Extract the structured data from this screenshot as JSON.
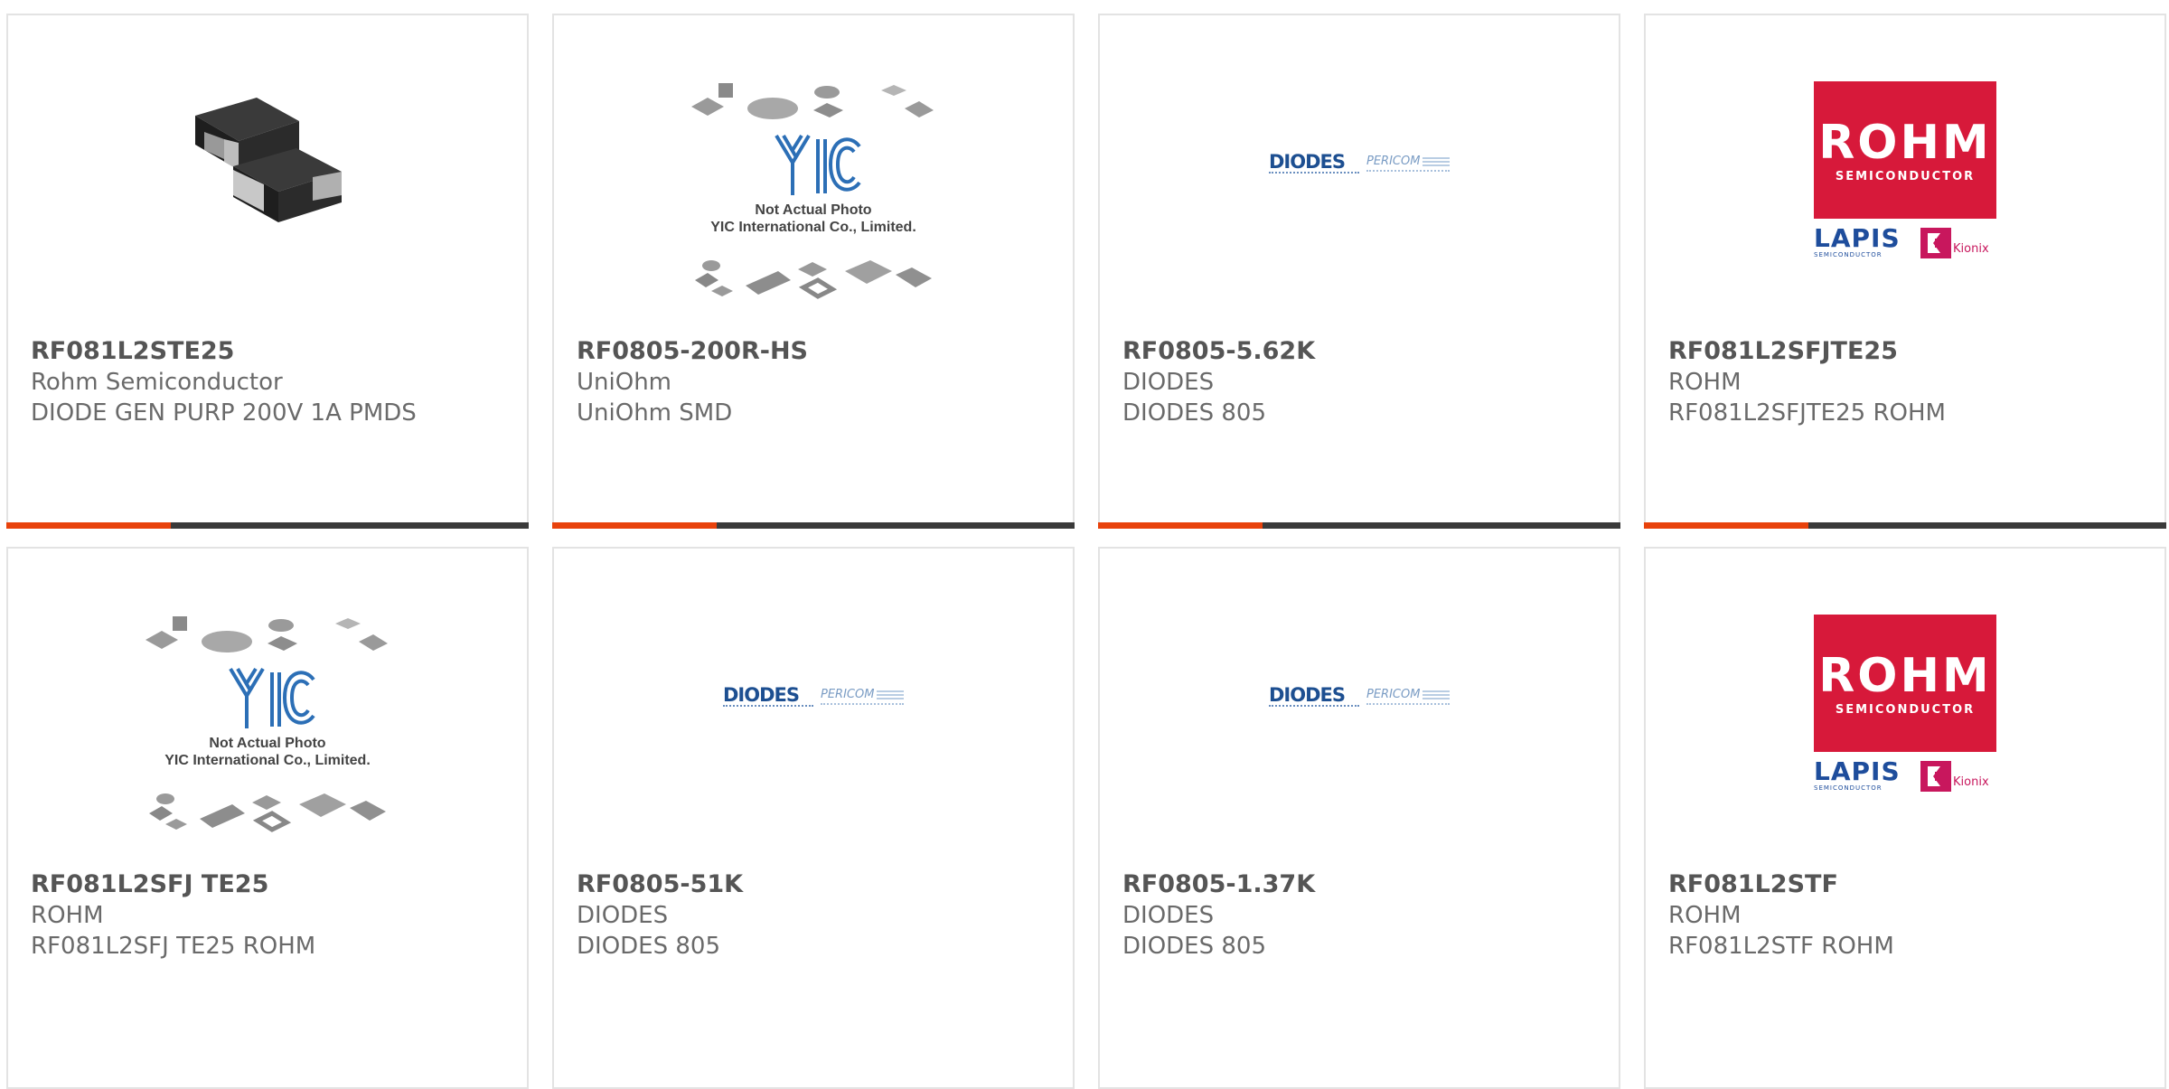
{
  "products": [
    {
      "part_number": "RF081L2STE25",
      "manufacturer": "Rohm Semiconductor",
      "description": "DIODE GEN PURP 200V 1A PMDS",
      "image": "diode-photo"
    },
    {
      "part_number": "RF0805-200R-HS",
      "manufacturer": "UniOhm",
      "description": "UniOhm SMD",
      "image": "yic-placeholder",
      "image_text": [
        "Not Actual Photo",
        "YIC International Co., Limited."
      ]
    },
    {
      "part_number": "RF0805-5.62K",
      "manufacturer": "DIODES",
      "description": "DIODES 805",
      "image": "diodes-pericom-logo",
      "image_text": [
        "DIODES",
        "PERICOM"
      ]
    },
    {
      "part_number": "RF081L2SFJTE25",
      "manufacturer": "ROHM",
      "description": "RF081L2SFJTE25 ROHM",
      "image": "rohm-lapis-kionix-logo",
      "image_text": [
        "ROHM",
        "SEMICONDUCTOR",
        "LAPIS",
        "SEMICONDUCTOR",
        "Kionix"
      ]
    },
    {
      "part_number": "RF081L2SFJ TE25",
      "manufacturer": "ROHM",
      "description": "RF081L2SFJ TE25 ROHM",
      "image": "yic-placeholder",
      "image_text": [
        "Not Actual Photo",
        "YIC International Co., Limited."
      ]
    },
    {
      "part_number": "RF0805-51K",
      "manufacturer": "DIODES",
      "description": "DIODES 805",
      "image": "diodes-pericom-logo",
      "image_text": [
        "DIODES",
        "PERICOM"
      ]
    },
    {
      "part_number": "RF0805-1.37K",
      "manufacturer": "DIODES",
      "description": "DIODES 805",
      "image": "diodes-pericom-logo",
      "image_text": [
        "DIODES",
        "PERICOM"
      ]
    },
    {
      "part_number": "RF081L2STF",
      "manufacturer": "ROHM",
      "description": "RF081L2STF ROHM",
      "image": "rohm-lapis-kionix-logo",
      "image_text": [
        "ROHM",
        "SEMICONDUCTOR",
        "LAPIS",
        "SEMICONDUCTOR",
        "Kionix"
      ]
    }
  ],
  "colors": {
    "accent": "#e8420c",
    "bar": "#3a3a3a",
    "border": "#e3e3e3",
    "rohm_red": "#d7193a",
    "diodes_blue": "#1d4f91"
  }
}
